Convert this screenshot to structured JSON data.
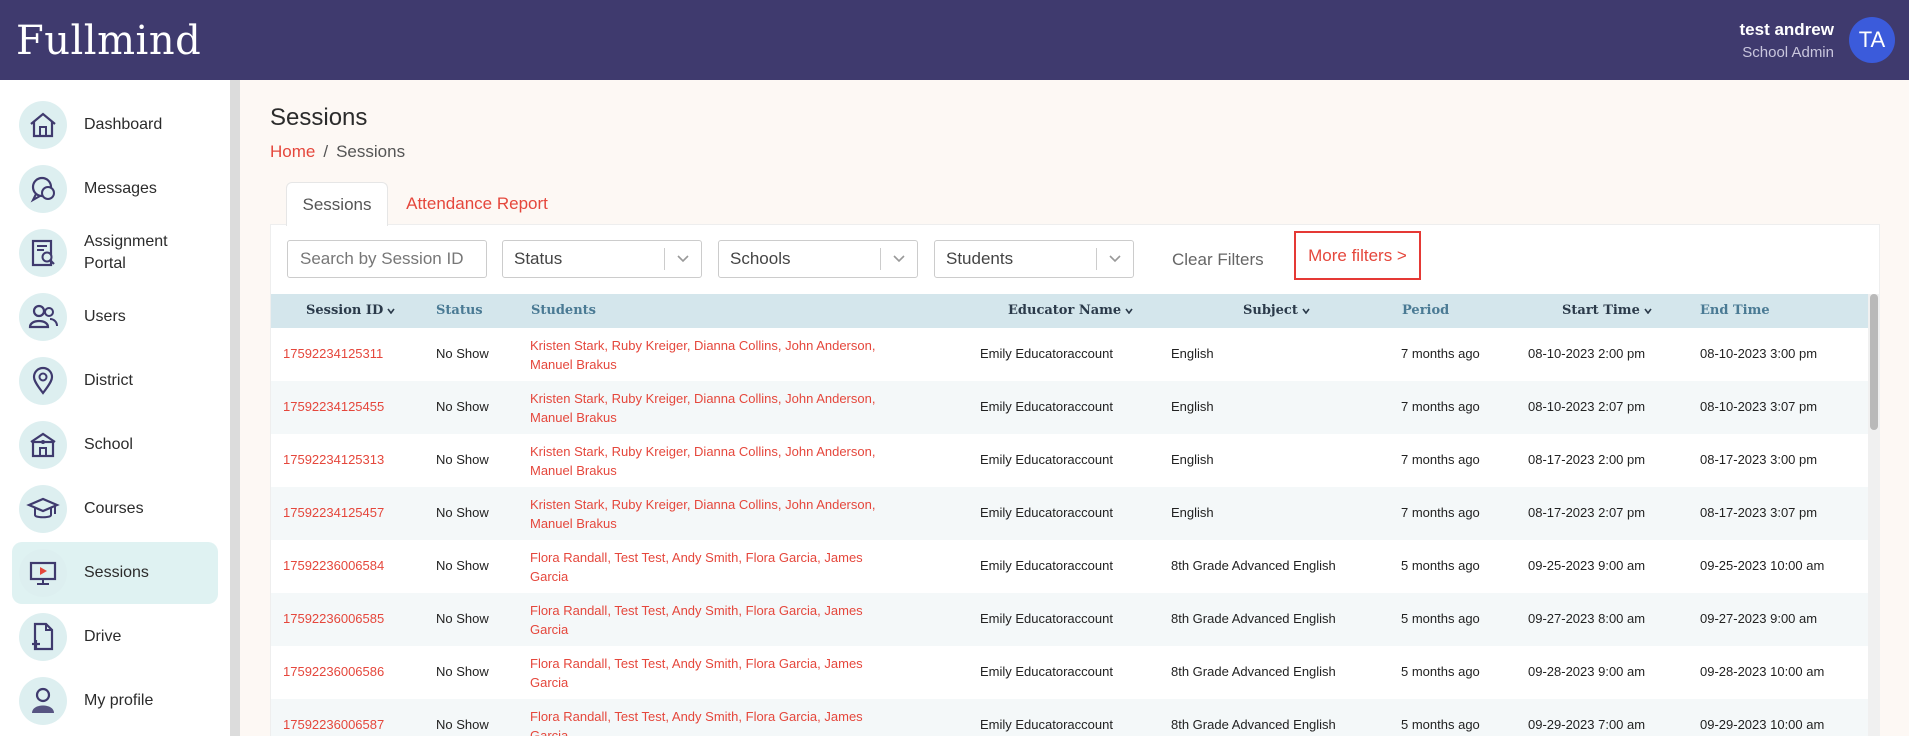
{
  "header": {
    "logo": "Fullmind",
    "user_name": "test andrew",
    "user_role": "School Admin",
    "avatar_initials": "TA",
    "bg_color": "#3f3a6e"
  },
  "sidebar": {
    "items": [
      {
        "label": "Dashboard",
        "icon": "home-icon"
      },
      {
        "label": "Messages",
        "icon": "chat-icon"
      },
      {
        "label": "Assignment Portal",
        "icon": "document-search-icon"
      },
      {
        "label": "Users",
        "icon": "users-icon"
      },
      {
        "label": "District",
        "icon": "map-pin-icon"
      },
      {
        "label": "School",
        "icon": "school-icon"
      },
      {
        "label": "Courses",
        "icon": "graduation-cap-icon"
      },
      {
        "label": "Sessions",
        "icon": "monitor-play-icon",
        "active": true
      },
      {
        "label": "Drive",
        "icon": "file-plus-icon"
      },
      {
        "label": "My profile",
        "icon": "person-icon"
      }
    ]
  },
  "page": {
    "title": "Sessions",
    "breadcrumb": {
      "home": "Home",
      "sep": "/",
      "current": "Sessions"
    },
    "tabs": [
      {
        "label": "Sessions",
        "active": true
      },
      {
        "label": "Attendance Report",
        "active": false
      }
    ]
  },
  "filters": {
    "search_placeholder": "Search by Session ID",
    "status": "Status",
    "schools": "Schools",
    "students": "Students",
    "clear": "Clear Filters",
    "more": "More filters >"
  },
  "table": {
    "columns": {
      "session_id": "Session ID",
      "status": "Status",
      "students": "Students",
      "educator": "Educator Name",
      "subject": "Subject",
      "period": "Period",
      "start": "Start Time",
      "end": "End Time"
    },
    "rows": [
      {
        "id": "17592234125311",
        "status": "No Show",
        "students": [
          "Kristen Stark",
          "Ruby Kreiger",
          "Dianna Collins",
          "John Anderson",
          "Manuel Brakus"
        ],
        "educator": "Emily Educatoraccount",
        "subject": "English",
        "period": "7 months ago",
        "start": "08-10-2023 2:00 pm",
        "end": "08-10-2023 3:00 pm"
      },
      {
        "id": "17592234125455",
        "status": "No Show",
        "students": [
          "Kristen Stark",
          "Ruby Kreiger",
          "Dianna Collins",
          "John Anderson",
          "Manuel Brakus"
        ],
        "educator": "Emily Educatoraccount",
        "subject": "English",
        "period": "7 months ago",
        "start": "08-10-2023 2:07 pm",
        "end": "08-10-2023 3:07 pm"
      },
      {
        "id": "17592234125313",
        "status": "No Show",
        "students": [
          "Kristen Stark",
          "Ruby Kreiger",
          "Dianna Collins",
          "John Anderson",
          "Manuel Brakus"
        ],
        "educator": "Emily Educatoraccount",
        "subject": "English",
        "period": "7 months ago",
        "start": "08-17-2023 2:00 pm",
        "end": "08-17-2023 3:00 pm"
      },
      {
        "id": "17592234125457",
        "status": "No Show",
        "students": [
          "Kristen Stark",
          "Ruby Kreiger",
          "Dianna Collins",
          "John Anderson",
          "Manuel Brakus"
        ],
        "educator": "Emily Educatoraccount",
        "subject": "English",
        "period": "7 months ago",
        "start": "08-17-2023 2:07 pm",
        "end": "08-17-2023 3:07 pm"
      },
      {
        "id": "17592236006584",
        "status": "No Show",
        "students": [
          "Flora Randall",
          "Test Test",
          "Andy Smith",
          "Flora Garcia",
          "James Garcia"
        ],
        "educator": "Emily Educatoraccount",
        "subject": "8th Grade Advanced English",
        "period": "5 months ago",
        "start": "09-25-2023 9:00 am",
        "end": "09-25-2023 10:00 am"
      },
      {
        "id": "17592236006585",
        "status": "No Show",
        "students": [
          "Flora Randall",
          "Test Test",
          "Andy Smith",
          "Flora Garcia",
          "James Garcia"
        ],
        "educator": "Emily Educatoraccount",
        "subject": "8th Grade Advanced English",
        "period": "5 months ago",
        "start": "09-27-2023 8:00 am",
        "end": "09-27-2023 9:00 am"
      },
      {
        "id": "17592236006586",
        "status": "No Show",
        "students": [
          "Flora Randall",
          "Test Test",
          "Andy Smith",
          "Flora Garcia",
          "James Garcia"
        ],
        "educator": "Emily Educatoraccount",
        "subject": "8th Grade Advanced English",
        "period": "5 months ago",
        "start": "09-28-2023 9:00 am",
        "end": "09-28-2023 10:00 am"
      },
      {
        "id": "17592236006587",
        "status": "No Show",
        "students": [
          "Flora Randall",
          "Test Test",
          "Andy Smith",
          "Flora Garcia",
          "James Garcia"
        ],
        "educator": "Emily Educatoraccount",
        "subject": "8th Grade Advanced English",
        "period": "5 months ago",
        "start": "09-29-2023 7:00 am",
        "end": "09-29-2023 10:00 am"
      }
    ]
  },
  "colors": {
    "accent": "#e5473c",
    "header_bg": "#3f3a6e",
    "table_header_bg": "#d4e6ec",
    "active_nav_bg": "#dff2f2"
  }
}
